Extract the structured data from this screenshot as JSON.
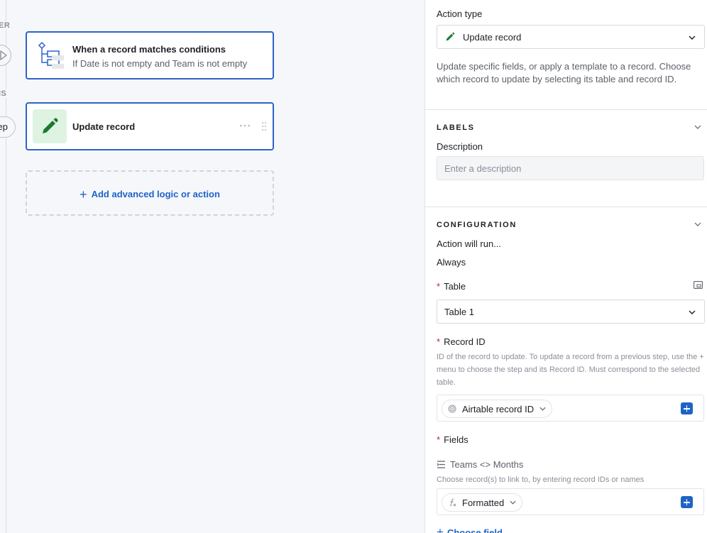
{
  "canvas": {
    "rail_labels": [
      "ER",
      "IS"
    ],
    "step_pill": "ep",
    "trigger": {
      "title": "When a record matches conditions",
      "subtitle": "If Date is not empty and Team is not empty"
    },
    "action": {
      "title": "Update record",
      "more": "···"
    },
    "add_logic": {
      "plus": "+",
      "label": "Add advanced logic or action"
    }
  },
  "panel": {
    "action_type": {
      "label": "Action type",
      "value": "Update record",
      "description": "Update specific fields, or apply a template to a record. Choose which record to update by selecting its table and record ID."
    },
    "labels": {
      "heading": "LABELS",
      "description_label": "Description",
      "description_placeholder": "Enter a description"
    },
    "configuration": {
      "heading": "CONFIGURATION",
      "run_label": "Action will run...",
      "run_value": "Always",
      "required_marker": "*",
      "table": {
        "label": "Table",
        "value": "Table 1"
      },
      "record_id": {
        "label": "Record ID",
        "help": "ID of the record to update. To update a record from a previous step, use the + menu to choose the step and its Record ID. Must correspond to the selected table.",
        "token": "Airtable record ID"
      },
      "fields": {
        "label": "Fields",
        "field_name": "Teams <> Months",
        "field_help": "Choose record(s) to link to, by entering record IDs or names",
        "token": "Formatted",
        "choose_field": "Choose field",
        "choose_plus": "+"
      }
    }
  },
  "colors": {
    "accent": "#1f63c6",
    "card_border": "#2d63c8",
    "action_icon_bg": "#dff3e2",
    "action_icon": "#1b7a2f",
    "required": "#c0262d"
  }
}
